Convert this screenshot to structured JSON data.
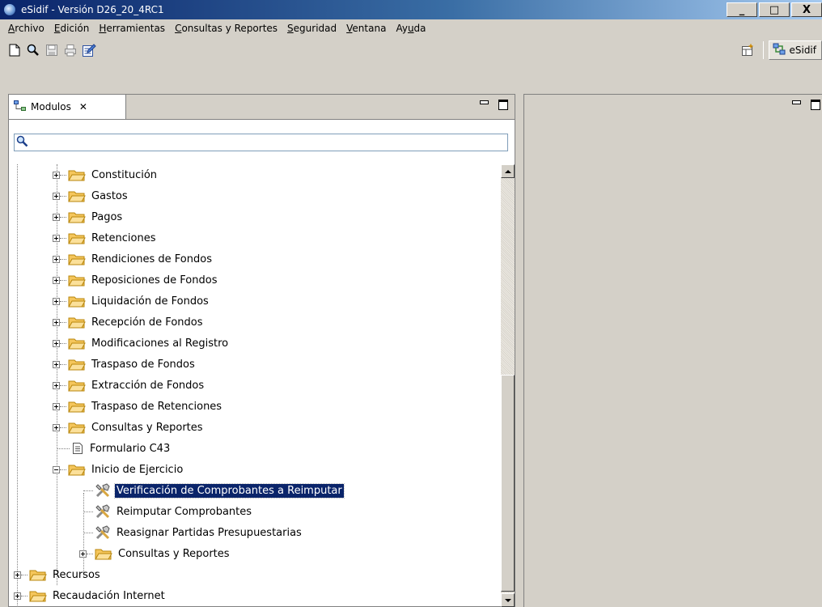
{
  "window": {
    "title": "eSidif - Versión D26_20_4RC1",
    "buttons": [
      "_",
      "□",
      "X"
    ]
  },
  "menu": {
    "items": [
      {
        "u": "A",
        "rest": "rchivo"
      },
      {
        "u": "E",
        "rest": "dición"
      },
      {
        "u": "H",
        "rest": "erramientas"
      },
      {
        "u": "C",
        "rest": "onsultas y Reportes"
      },
      {
        "u": "S",
        "rest": "eguridad"
      },
      {
        "u": "V",
        "rest": "entana"
      },
      {
        "pre": "Ay",
        "u": "u",
        "rest": "da"
      }
    ]
  },
  "toolbar": {
    "icons": [
      "new-file-icon",
      "search-icon",
      "save-icon",
      "print-icon",
      "edit-document-icon"
    ],
    "perspective_label": "eSidif"
  },
  "view": {
    "tab_label": "Modulos",
    "close_glyph": "✕",
    "search_placeholder": ""
  },
  "tree": {
    "items": [
      {
        "label": "Constitución"
      },
      {
        "label": "Gastos"
      },
      {
        "label": "Pagos"
      },
      {
        "label": "Retenciones"
      },
      {
        "label": "Rendiciones de Fondos"
      },
      {
        "label": "Reposiciones de Fondos"
      },
      {
        "label": "Liquidación de Fondos"
      },
      {
        "label": "Recepción de Fondos"
      },
      {
        "label": "Modificaciones al Registro"
      },
      {
        "label": "Traspaso de Fondos"
      },
      {
        "label": "Extracción de Fondos"
      },
      {
        "label": "Traspaso de Retenciones"
      },
      {
        "label": "Consultas y Reportes"
      },
      {
        "label": "Formulario C43"
      },
      {
        "label": "Inicio de Ejercicio"
      },
      {
        "label": "Verificación de Comprobantes a Reimputar"
      },
      {
        "label": "Reimputar Comprobantes"
      },
      {
        "label": "Reasignar Partidas Presupuestarias"
      },
      {
        "label": "Consultas y Reportes"
      },
      {
        "label": "Recursos"
      },
      {
        "label": "Recaudación Internet"
      }
    ]
  },
  "colors": {
    "selection": "#0a246a",
    "folder": "#f5c65c",
    "title_bar": "#0a246a"
  }
}
